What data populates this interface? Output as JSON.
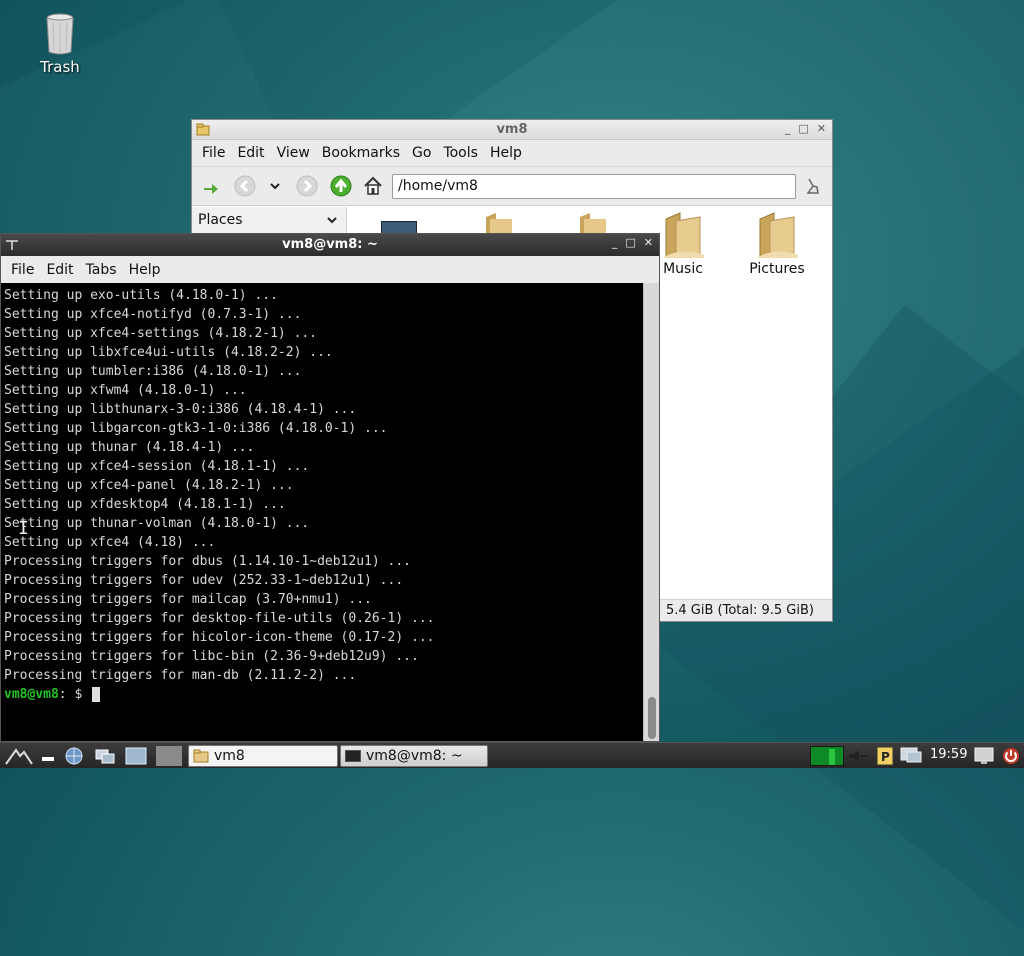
{
  "desktop": {
    "trash_label": "Trash"
  },
  "file_manager": {
    "title": "vm8",
    "menu": [
      "File",
      "Edit",
      "View",
      "Bookmarks",
      "Go",
      "Tools",
      "Help"
    ],
    "address": "/home/vm8",
    "sidebar_header": "Places",
    "folders": [
      {
        "label": "Music",
        "icon": "folder-music-icon"
      },
      {
        "label": "Pictures",
        "icon": "folder-pictures-icon"
      }
    ],
    "status": "5.4 GiB (Total: 9.5 GiB)"
  },
  "terminal": {
    "title": "vm8@vm8: ~",
    "menu": [
      "File",
      "Edit",
      "Tabs",
      "Help"
    ],
    "lines": [
      "Setting up exo-utils (4.18.0-1) ...",
      "Setting up xfce4-notifyd (0.7.3-1) ...",
      "Setting up xfce4-settings (4.18.2-1) ...",
      "Setting up libxfce4ui-utils (4.18.2-2) ...",
      "Setting up tumbler:i386 (4.18.0-1) ...",
      "Setting up xfwm4 (4.18.0-1) ...",
      "Setting up libthunarx-3-0:i386 (4.18.4-1) ...",
      "Setting up libgarcon-gtk3-1-0:i386 (4.18.0-1) ...",
      "Setting up thunar (4.18.4-1) ...",
      "Setting up xfce4-session (4.18.1-1) ...",
      "Setting up xfce4-panel (4.18.2-1) ...",
      "Setting up xfdesktop4 (4.18.1-1) ...",
      "Setting up thunar-volman (4.18.0-1) ...",
      "Setting up xfce4 (4.18) ...",
      "Processing triggers for dbus (1.14.10-1~deb12u1) ...",
      "Processing triggers for udev (252.33-1~deb12u1) ...",
      "Processing triggers for mailcap (3.70+nmu1) ...",
      "Processing triggers for desktop-file-utils (0.26-1) ...",
      "Processing triggers for hicolor-icon-theme (0.17-2) ...",
      "Processing triggers for libc-bin (2.36-9+deb12u9) ...",
      "Processing triggers for man-db (2.11.2-2) ..."
    ],
    "prompt_user": "vm8@vm8",
    "prompt_rest": ": $"
  },
  "taskbar": {
    "tasks": [
      {
        "label": "vm8",
        "state": "active"
      },
      {
        "label": "vm8@vm8: ~",
        "state": "inactive"
      }
    ],
    "clock": "19:59"
  }
}
